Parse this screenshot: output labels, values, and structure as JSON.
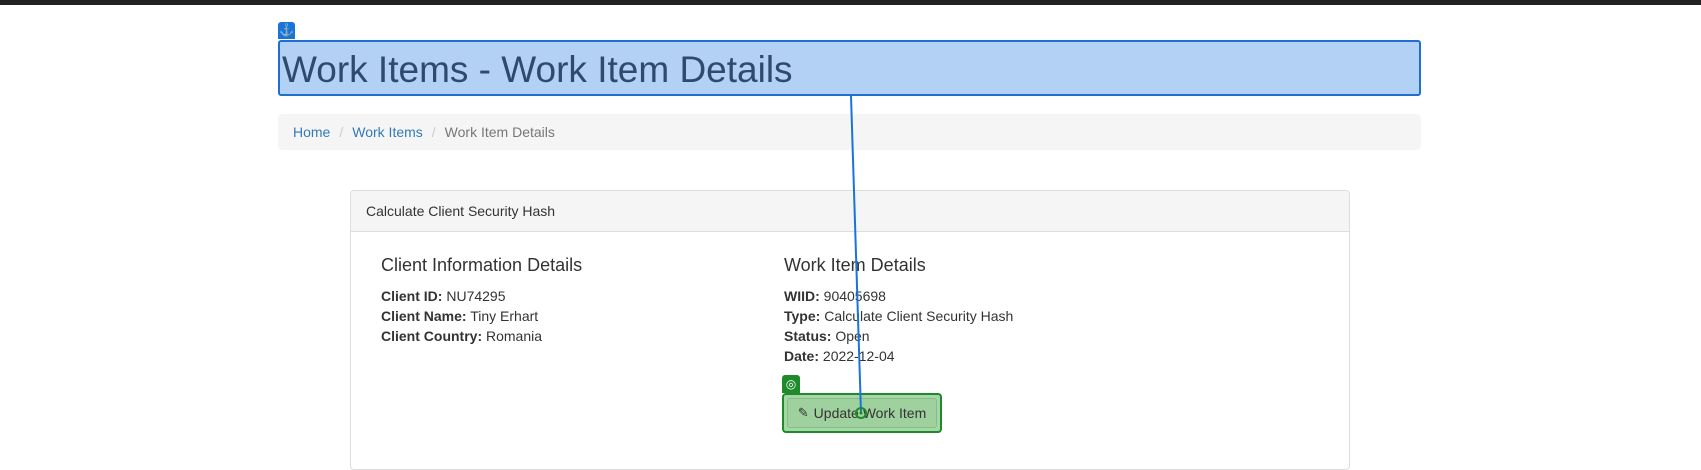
{
  "page": {
    "title": "Work Items - Work Item Details"
  },
  "breadcrumb": {
    "home": "Home",
    "work_items": "Work Items",
    "current": "Work Item Details",
    "separator": "/"
  },
  "panel": {
    "heading": "Calculate Client Security Hash",
    "client": {
      "title": "Client Information Details",
      "id_label": "Client ID:",
      "id_value": "NU74295",
      "name_label": "Client Name:",
      "name_value": "Tiny Erhart",
      "country_label": "Client Country:",
      "country_value": "Romania"
    },
    "work_item": {
      "title": "Work Item Details",
      "wiid_label": "WIID:",
      "wiid_value": "90405698",
      "type_label": "Type:",
      "type_value": "Calculate Client Security Hash",
      "status_label": "Status:",
      "status_value": "Open",
      "date_label": "Date:",
      "date_value": "2022-12-04"
    },
    "update_button": {
      "label": "Update Work Item",
      "icon": "pencil-icon"
    }
  },
  "overlay": {
    "anchor_icon": "anchor-icon",
    "target_icon": "target-icon",
    "anchor_color": "#1a73d9",
    "target_color": "#1e8a2a"
  }
}
